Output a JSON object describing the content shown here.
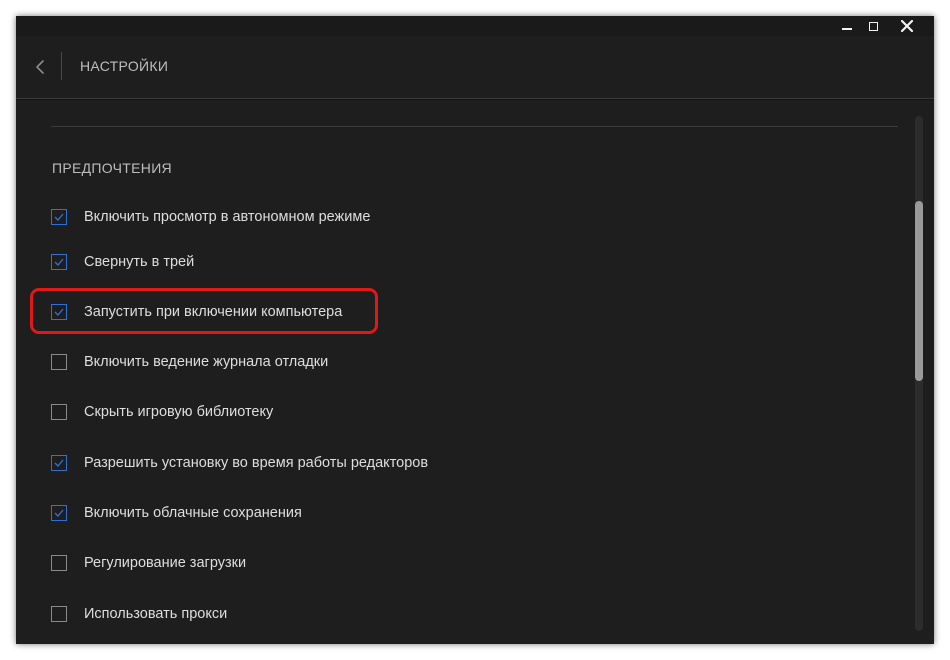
{
  "header": {
    "title": "НАСТРОЙКИ"
  },
  "section": {
    "title": "ПРЕДПОЧТЕНИЯ"
  },
  "options": [
    {
      "label": "Включить просмотр в автономном режиме",
      "checked": true
    },
    {
      "label": "Свернуть в трей",
      "checked": true
    },
    {
      "label": "Запустить при включении компьютера",
      "checked": true,
      "highlighted": true
    },
    {
      "label": "Включить ведение журнала отладки",
      "checked": false
    },
    {
      "label": "Скрыть игровую библиотеку",
      "checked": false
    },
    {
      "label": "Разрешить установку во время работы редакторов",
      "checked": true
    },
    {
      "label": "Включить облачные сохранения",
      "checked": true
    },
    {
      "label": "Регулирование загрузки",
      "checked": false
    },
    {
      "label": "Использовать прокси",
      "checked": false
    }
  ],
  "colors": {
    "background": "#1e1e1e",
    "accent": "#2f71d0",
    "highlight": "#e01818"
  },
  "icons": {
    "back": "chevron-left-icon",
    "minimize": "minimize-icon",
    "maximize": "maximize-icon",
    "close": "close-icon",
    "check": "checkmark-icon"
  }
}
